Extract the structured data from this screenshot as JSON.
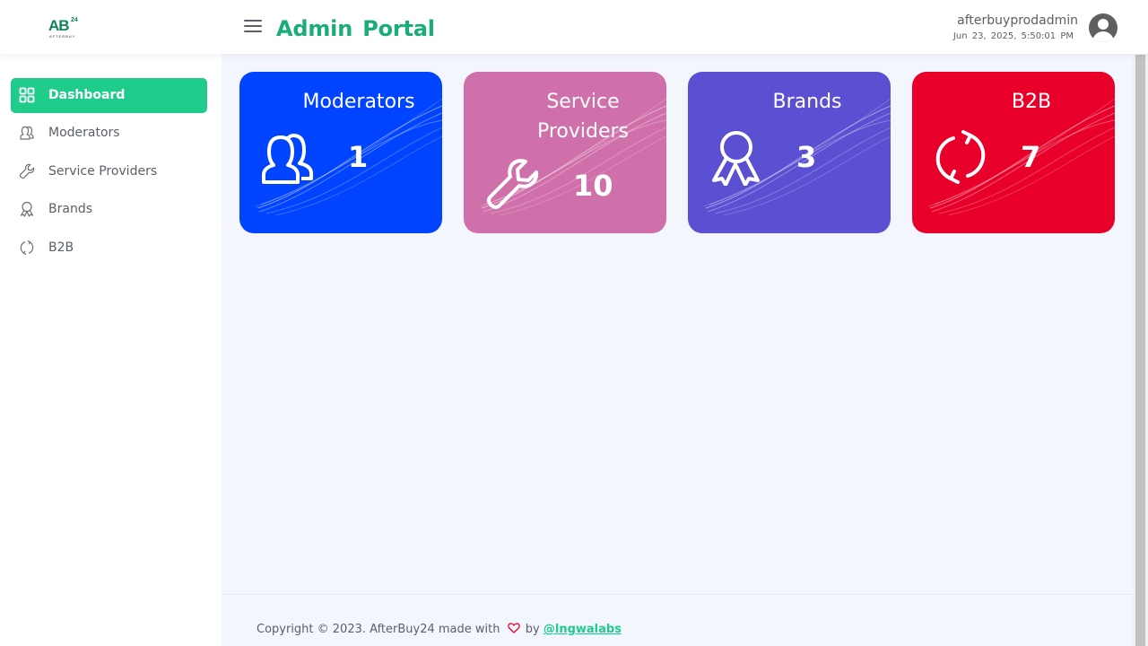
{
  "header": {
    "logo_text": "AB",
    "logo_superscript": "24",
    "logo_subtitle": "AFTERBUY",
    "title": "Admin Portal",
    "user_name": "afterbuyprodadmin",
    "datetime": "Jun 23, 2025, 5:50:01 PM"
  },
  "sidebar": {
    "items": [
      {
        "label": "Dashboard",
        "icon": "dashboard-grid-icon",
        "active": true
      },
      {
        "label": "Moderators",
        "icon": "users-icon",
        "active": false
      },
      {
        "label": "Service Providers",
        "icon": "wrench-icon",
        "active": false
      },
      {
        "label": "Brands",
        "icon": "award-icon",
        "active": false
      },
      {
        "label": "B2B",
        "icon": "refresh-icon",
        "active": false
      }
    ]
  },
  "cards": [
    {
      "title": "Moderators",
      "count": "1",
      "icon": "users-icon",
      "color": "#0044ff"
    },
    {
      "title": "Service Providers",
      "count": "10",
      "icon": "wrench-icon",
      "color": "#d070aa"
    },
    {
      "title": "Brands",
      "count": "3",
      "icon": "award-icon",
      "color": "#5b4fd2"
    },
    {
      "title": "B2B",
      "count": "7",
      "icon": "refresh-icon",
      "color": "#e8002a"
    }
  ],
  "footer": {
    "copyright": "Copyright © 2023. AfterBuy24 made with",
    "by": "by",
    "link": "@lngwalabs"
  },
  "colors": {
    "accent": "#1fcc8c",
    "title_green": "#1aae76"
  }
}
